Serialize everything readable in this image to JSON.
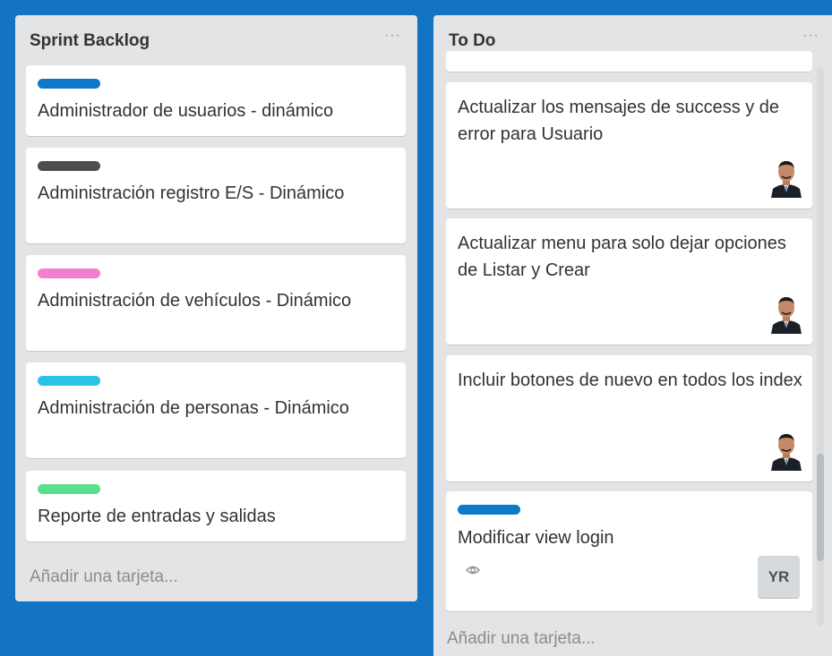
{
  "lists": [
    {
      "title": "Sprint Backlog",
      "menu": "···",
      "cards": [
        {
          "label_color": "#0f79c9",
          "title": "Administrador de usuarios - dinámico"
        },
        {
          "label_color": "#4d4d4d",
          "title": "Administración registro E/S - Dinámico"
        },
        {
          "label_color": "#f47fcf",
          "title": "Administración de vehículos - Dinámico"
        },
        {
          "label_color": "#29c3e8",
          "title": "Administración de personas - Dinámico"
        },
        {
          "label_color": "#58e08a",
          "title": "Reporte de entradas y salidas"
        }
      ],
      "add_card": "Añadir una tarjeta..."
    },
    {
      "title": "To Do",
      "menu": "···",
      "cards": [
        {
          "title": "Actualizar los mensajes de success y de error para Usuario",
          "member": "avatar-photo"
        },
        {
          "title": "Actualizar menu para solo dejar opciones de Listar y Crear",
          "member": "avatar-photo"
        },
        {
          "title": "Incluir botones de nuevo en todos los index",
          "member": "avatar-photo"
        },
        {
          "label_color": "#0f79c9",
          "title": "Modificar view login",
          "badge_icon": "eye-icon",
          "member_initials": "YR"
        }
      ],
      "add_card": "Añadir una tarjeta..."
    }
  ],
  "colors": {
    "board_background": "#1474c4",
    "list_background": "#e2e4e6"
  }
}
